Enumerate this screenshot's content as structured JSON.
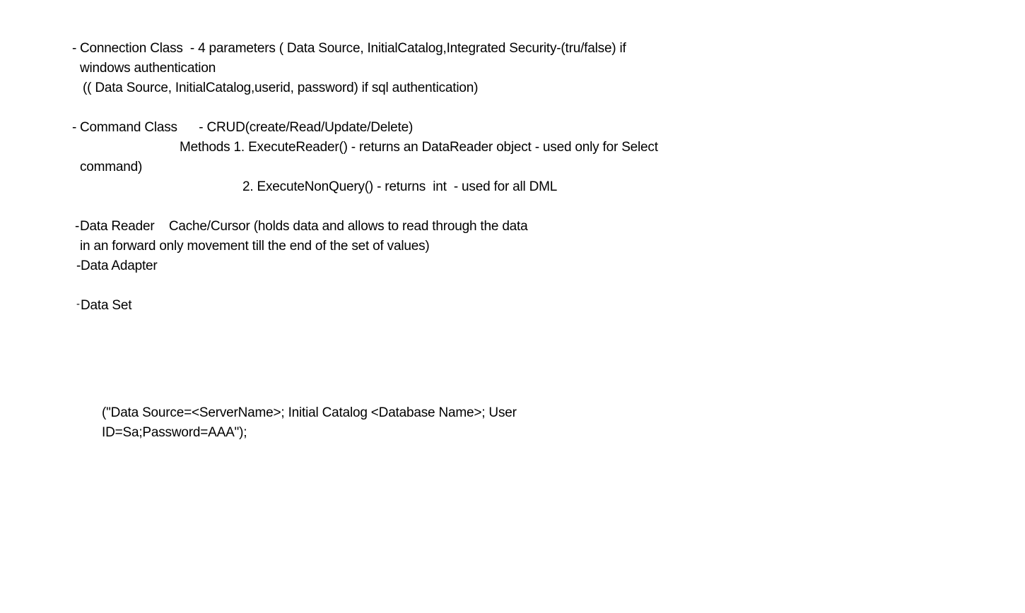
{
  "connection": {
    "bullet": "-",
    "line1": "Connection Class  - 4 parameters ( Data Source, InitialCatalog,Integrated Security-(tru/false) if",
    "line2": "windows authentication",
    "line3": "(( Data Source, InitialCatalog,userid, password) if sql authentication)"
  },
  "command": {
    "bullet": "-",
    "line1": "Command Class      - CRUD(create/Read/Update/Delete)",
    "line2": "Methods 1. ExecuteReader() - returns an DataReader object - used only for Select",
    "line3": "command)",
    "line4": "2. ExecuteNonQuery() - returns  int  - used for all DML"
  },
  "data_reader": {
    "bullet": "-",
    "line1": "Data Reader    Cache/Cursor (holds data and allows to read through the data",
    "line2": "in an forward only movement till the end of the set of values)"
  },
  "data_adapter": {
    "bullet": "-",
    "line1": "Data Adapter"
  },
  "data_set": {
    "bullet": "-",
    "line1": "Data Set"
  },
  "connection_string": {
    "line1": "(\"Data Source=<ServerName>; Initial Catalog <Database Name>; User",
    "line2": "ID=Sa;Password=AAA\");"
  }
}
